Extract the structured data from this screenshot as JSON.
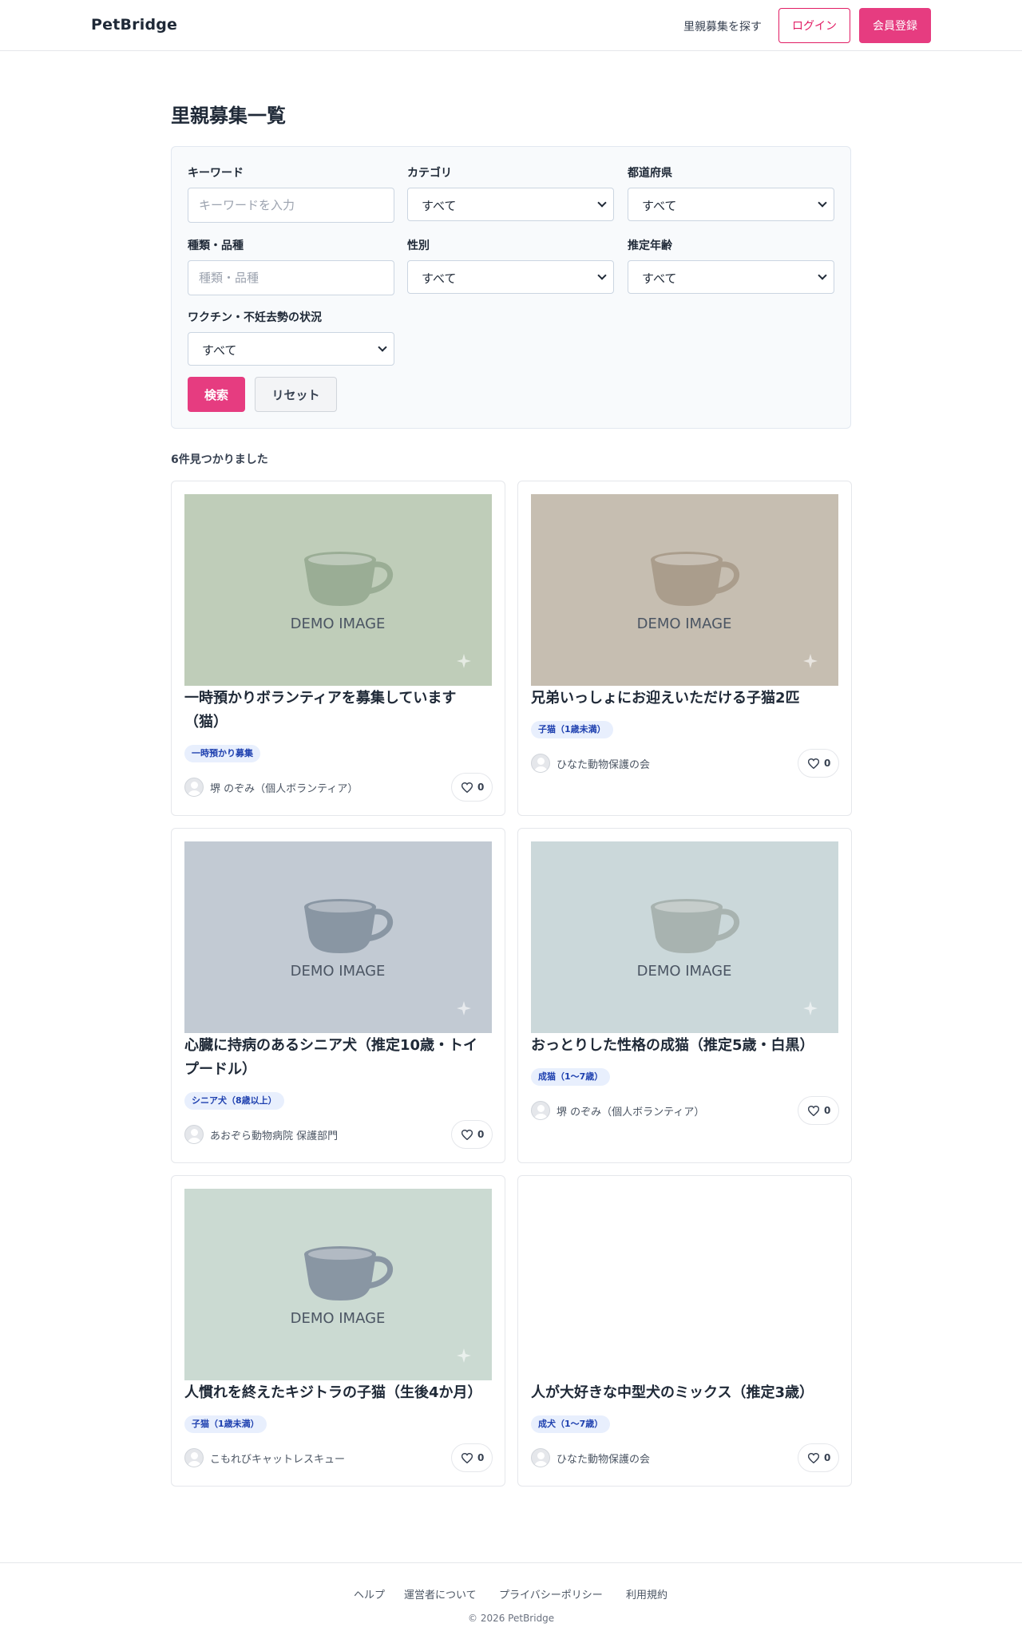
{
  "header": {
    "brand": "PetBridge",
    "nav_link": "里親募集を探す",
    "login_label": "ログイン",
    "signup_label": "会員登録"
  },
  "page_title": "里親募集一覧",
  "filters": {
    "keyword": {
      "label": "キーワード",
      "placeholder": "キーワードを入力"
    },
    "category": {
      "label": "カテゴリ",
      "value": "すべて"
    },
    "prefecture": {
      "label": "都道府県",
      "value": "すべて"
    },
    "breed": {
      "label": "種類・品種",
      "placeholder": "種類・品種"
    },
    "gender": {
      "label": "性別",
      "value": "すべて"
    },
    "age": {
      "label": "推定年齢",
      "value": "すべて"
    },
    "vaccine": {
      "label": "ワクチン・不妊去勢の状況",
      "value": "すべて"
    },
    "search_label": "検索",
    "reset_label": "リセット"
  },
  "result_count": "6件見つかりました",
  "listings": [
    {
      "title": "一時預かりボランティアを募集しています（猫）",
      "badge": "一時預かり募集",
      "owner": "堺 のぞみ（個人ボランティア）",
      "likes": "0",
      "image_text": "DEMO IMAGE",
      "image_bg": "#bfcdb9",
      "cup_color": "#9aad95"
    },
    {
      "title": "兄弟いっしょにお迎えいただける子猫2匹",
      "badge": "子猫（1歳未満）",
      "owner": "ひなた動物保護の会",
      "likes": "0",
      "image_text": "DEMO IMAGE",
      "image_bg": "#c6beb1",
      "cup_color": "#aa9d8c"
    },
    {
      "title": "心臓に持病のあるシニア犬（推定10歳・トイプードル）",
      "badge": "シニア犬（8歳以上）",
      "owner": "あおぞら動物病院 保護部門",
      "likes": "0",
      "image_text": "DEMO IMAGE",
      "image_bg": "#c2cad3",
      "cup_color": "#8996a3"
    },
    {
      "title": "おっとりした性格の成猫（推定5歳・白黒）",
      "badge": "成猫（1〜7歳）",
      "owner": "堺 のぞみ（個人ボランティア）",
      "likes": "0",
      "image_text": "DEMO IMAGE",
      "image_bg": "#cbd8da",
      "cup_color": "#a8b3b0"
    },
    {
      "title": "人慣れを終えたキジトラの子猫（生後4か月）",
      "badge": "子猫（1歳未満）",
      "owner": "こもれびキャットレスキュー",
      "likes": "0",
      "image_text": "DEMO IMAGE",
      "image_bg": "#cbdad2",
      "cup_color": "#8996a3"
    },
    {
      "title": "人が大好きな中型犬のミックス（推定3歳）",
      "badge": "成犬（1〜7歳）",
      "owner": "ひなた動物保護の会",
      "likes": "0",
      "image_text": "",
      "image_bg": "#ffffff",
      "cup_color": ""
    }
  ],
  "footer": {
    "links": [
      "ヘルプ",
      "運営者について",
      "プライバシーポリシー",
      "利用規約"
    ],
    "copyright": "© 2026 PetBridge"
  },
  "colors": {
    "accent": "#e63c80",
    "badge_bg": "#e8effd",
    "badge_text": "#1e40af"
  }
}
